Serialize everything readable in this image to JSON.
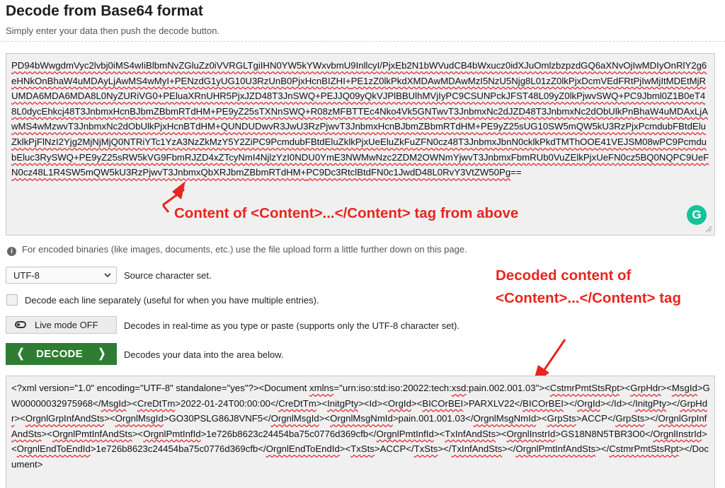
{
  "page": {
    "title": "Decode from Base64 format",
    "subtitle": "Simply enter your data then push the decode button."
  },
  "input_area": {
    "segments": [
      {
        "t": "PD94bWwgdmVyc2lvbj0iMS4wIiBlbmNvZGluZz0iVVRGLTgiIHN0YW5kYWxvbmU9InllcyI/PjxEb2N1bWVudCB4bWxucz0idXJuOmlzbzpzdGQ6aXNvOjIwMDIyOnRlY2g6eHNkOnBhaW4uMDAyLjAwMS4wMyI+",
        "u": true
      },
      {
        "t": "PENzdG1yUG10U3RzUnB0PjxHcnBIZHI+",
        "u": true
      },
      {
        "t": "PE1zZ0lkPkdXMDAwMDAwMzI5NzU5Njg8L01zZ0lkPjxDcmVEdFRtPjIwMjItMDEtMjRUMDA6MDA6MDA8L0NyZURiVG0+",
        "u": true
      },
      {
        "t": "PEluaXRnUHR5PjxJZD48T3JnSWQ+",
        "u": true
      },
      {
        "t": "PEJJQ09yQkVJPlBBUlhMVjIyPC9CSUNPckJFST48L09yZ0lkPjwvSWQ+",
        "u": true
      },
      {
        "t": "PC9Jbml0Z1B0eT48L0dycEhkcj48T3JnbmxHcnBJbmZBbmRTdHM+",
        "u": true
      },
      {
        "t": "PE9yZ25sTXNnSWQ+",
        "u": true
      },
      {
        "t": "R08zMFBTTEc4Nko4Vk5GNTwvT3JnbmxNc2dJZD48T3JnbmxNc2dObUlkPnBhaW4uMDAxLjAwMS4wMzwvT3JnbmxNc2dObUlkPjxHcnBTdHM+",
        "u": true
      },
      {
        "t": "QUNDUDwvR3JwU3RzPjwvT3JnbmxHcnBJbmZBbmRTdHM+",
        "u": true
      },
      {
        "t": "PE9yZ25sUG10SW5mQW5kU3RzPjxPcmdubFBtdEluZklkPjFlNzI2Yjg2MjNjMjQ0NTRiYTc1YzA3NzZkMzY5Y2ZiPC9PcmdubFBtdEluZklkPjxUeEluZkFuZFN0cz48T3JnbmxJbnN0cklkPkdTMThOOE41VEJSM08wPC9PcmdubEluc3RySWQ+",
        "u": true
      },
      {
        "t": "PE9yZ25sRW5kVG9FbmRJZD4xZTcyNmI4NjlzYzI0NDU0YmE3NWMwNzc2ZDM2OWNmYjwvT3JnbmxFbmRUb0VuZElkPjxUeFN0cz5BQ0NQPC9UeFN0cz48L1R4SW5mQW5kU3RzPjwvT3JnbmxQbXRJbmZBbmRTdHM+",
        "u": true
      },
      {
        "t": "PC9Dc3RtclBtdFN0c1JwdD48L0RvY3VtZW50Pg",
        "u": true
      },
      {
        "t": "==",
        "u": false
      }
    ]
  },
  "annotations": {
    "input_note": "Content of <Content>...</Content> tag from above",
    "output_note": "Decoded content of <Content>...</Content> tag"
  },
  "info_note": "For encoded binaries (like images, documents, etc.) use the file upload form a little further down on this page.",
  "options": {
    "charset_value": "UTF-8",
    "charset_label": "Source character set.",
    "each_line_label": "Decode each line separately (useful for when you have multiple entries).",
    "live_mode_button": "Live mode OFF",
    "live_mode_label": "Decodes in real-time as you type or paste (supports only the UTF-8 character set).",
    "decode_button": "DECODE",
    "decode_label": "Decodes your data into the area below."
  },
  "output_area": {
    "segments": [
      {
        "t": "<?xml version=\"1.0\" encoding=\"UTF-8\" standalone=\"yes\"?><Document ",
        "u": false
      },
      {
        "t": "xmlns",
        "u": true
      },
      {
        "t": "=\"urn:iso:std:iso:20022:tech:",
        "u": false
      },
      {
        "t": "xsd",
        "u": true
      },
      {
        "t": ":pain.002.001.03\"><",
        "u": false
      },
      {
        "t": "CstmrPmtStsRpt",
        "u": true
      },
      {
        "t": "><",
        "u": false
      },
      {
        "t": "GrpHdr",
        "u": true
      },
      {
        "t": "><",
        "u": false
      },
      {
        "t": "MsgId",
        "u": true
      },
      {
        "t": ">GW00000032975968</",
        "u": false
      },
      {
        "t": "MsgId",
        "u": true
      },
      {
        "t": "><",
        "u": false
      },
      {
        "t": "CreDtTm",
        "u": true
      },
      {
        "t": ">2022-01-24T00:00:00</",
        "u": false
      },
      {
        "t": "CreDtTm",
        "u": true
      },
      {
        "t": "><",
        "u": false
      },
      {
        "t": "InitgPty",
        "u": true
      },
      {
        "t": "><Id><",
        "u": false
      },
      {
        "t": "OrgId",
        "u": true
      },
      {
        "t": "><",
        "u": false
      },
      {
        "t": "BICOrBEI",
        "u": true
      },
      {
        "t": ">PARXLV22</",
        "u": false
      },
      {
        "t": "BICOrBEI",
        "u": true
      },
      {
        "t": "></",
        "u": false
      },
      {
        "t": "OrgId",
        "u": true
      },
      {
        "t": "></Id></",
        "u": false
      },
      {
        "t": "InitgPty",
        "u": true
      },
      {
        "t": "></",
        "u": false
      },
      {
        "t": "GrpHdr",
        "u": true
      },
      {
        "t": "><",
        "u": false
      },
      {
        "t": "OrgnlGrpInfAndSts",
        "u": true
      },
      {
        "t": "><",
        "u": false
      },
      {
        "t": "OrgnlMsgId",
        "u": true
      },
      {
        "t": ">GO30PSLG86J8VNF5</",
        "u": false
      },
      {
        "t": "OrgnlMsgId",
        "u": true
      },
      {
        "t": "><",
        "u": false
      },
      {
        "t": "OrgnlMsgNmId",
        "u": true
      },
      {
        "t": ">pain.001.001.03</",
        "u": false
      },
      {
        "t": "OrgnlMsgNmId",
        "u": true
      },
      {
        "t": "><",
        "u": false
      },
      {
        "t": "GrpSts",
        "u": true
      },
      {
        "t": ">ACCP</",
        "u": false
      },
      {
        "t": "GrpSts",
        "u": true
      },
      {
        "t": "></",
        "u": false
      },
      {
        "t": "OrgnlGrpInfAndSts",
        "u": true
      },
      {
        "t": "><",
        "u": false
      },
      {
        "t": "OrgnlPmtInfAndSts",
        "u": true
      },
      {
        "t": "><",
        "u": false
      },
      {
        "t": "OrgnlPmtInfId",
        "u": true
      },
      {
        "t": ">1e726b8623c24454ba75c0776d369cfb</",
        "u": false
      },
      {
        "t": "OrgnlPmtInfId",
        "u": true
      },
      {
        "t": "><",
        "u": false
      },
      {
        "t": "TxInfAndSts",
        "u": true
      },
      {
        "t": "><",
        "u": false
      },
      {
        "t": "OrgnlInstrId",
        "u": true
      },
      {
        "t": ">GS18N8N5TBR3O0</",
        "u": false
      },
      {
        "t": "OrgnlInstrId",
        "u": true
      },
      {
        "t": "><",
        "u": false
      },
      {
        "t": "OrgnlEndToEndId",
        "u": true
      },
      {
        "t": ">1e726b8623c24454ba75c0776d369cfb</",
        "u": false
      },
      {
        "t": "OrgnlEndToEndId",
        "u": true
      },
      {
        "t": "><",
        "u": false
      },
      {
        "t": "TxSts",
        "u": true
      },
      {
        "t": ">ACCP</",
        "u": false
      },
      {
        "t": "TxSts",
        "u": true
      },
      {
        "t": "></",
        "u": false
      },
      {
        "t": "TxInfAndSts",
        "u": true
      },
      {
        "t": "></",
        "u": false
      },
      {
        "t": "OrgnlPmtInfAndSts",
        "u": true
      },
      {
        "t": "></",
        "u": false
      },
      {
        "t": "CstmrPmtStsRpt",
        "u": true
      },
      {
        "t": "></Document>",
        "u": false
      }
    ]
  },
  "icons": {
    "info": "info-icon",
    "select_arrow": "chevron-down-icon",
    "toggle": "toggle-icon",
    "decode_left": "chevron-left-icon",
    "decode_right": "chevron-right-icon",
    "grammarly": "grammarly-icon"
  },
  "colors": {
    "accent_green": "#2e7d32",
    "annotation_red": "#e8251e",
    "grammarly_green": "#15c39a",
    "spell_underline": "#d33"
  }
}
